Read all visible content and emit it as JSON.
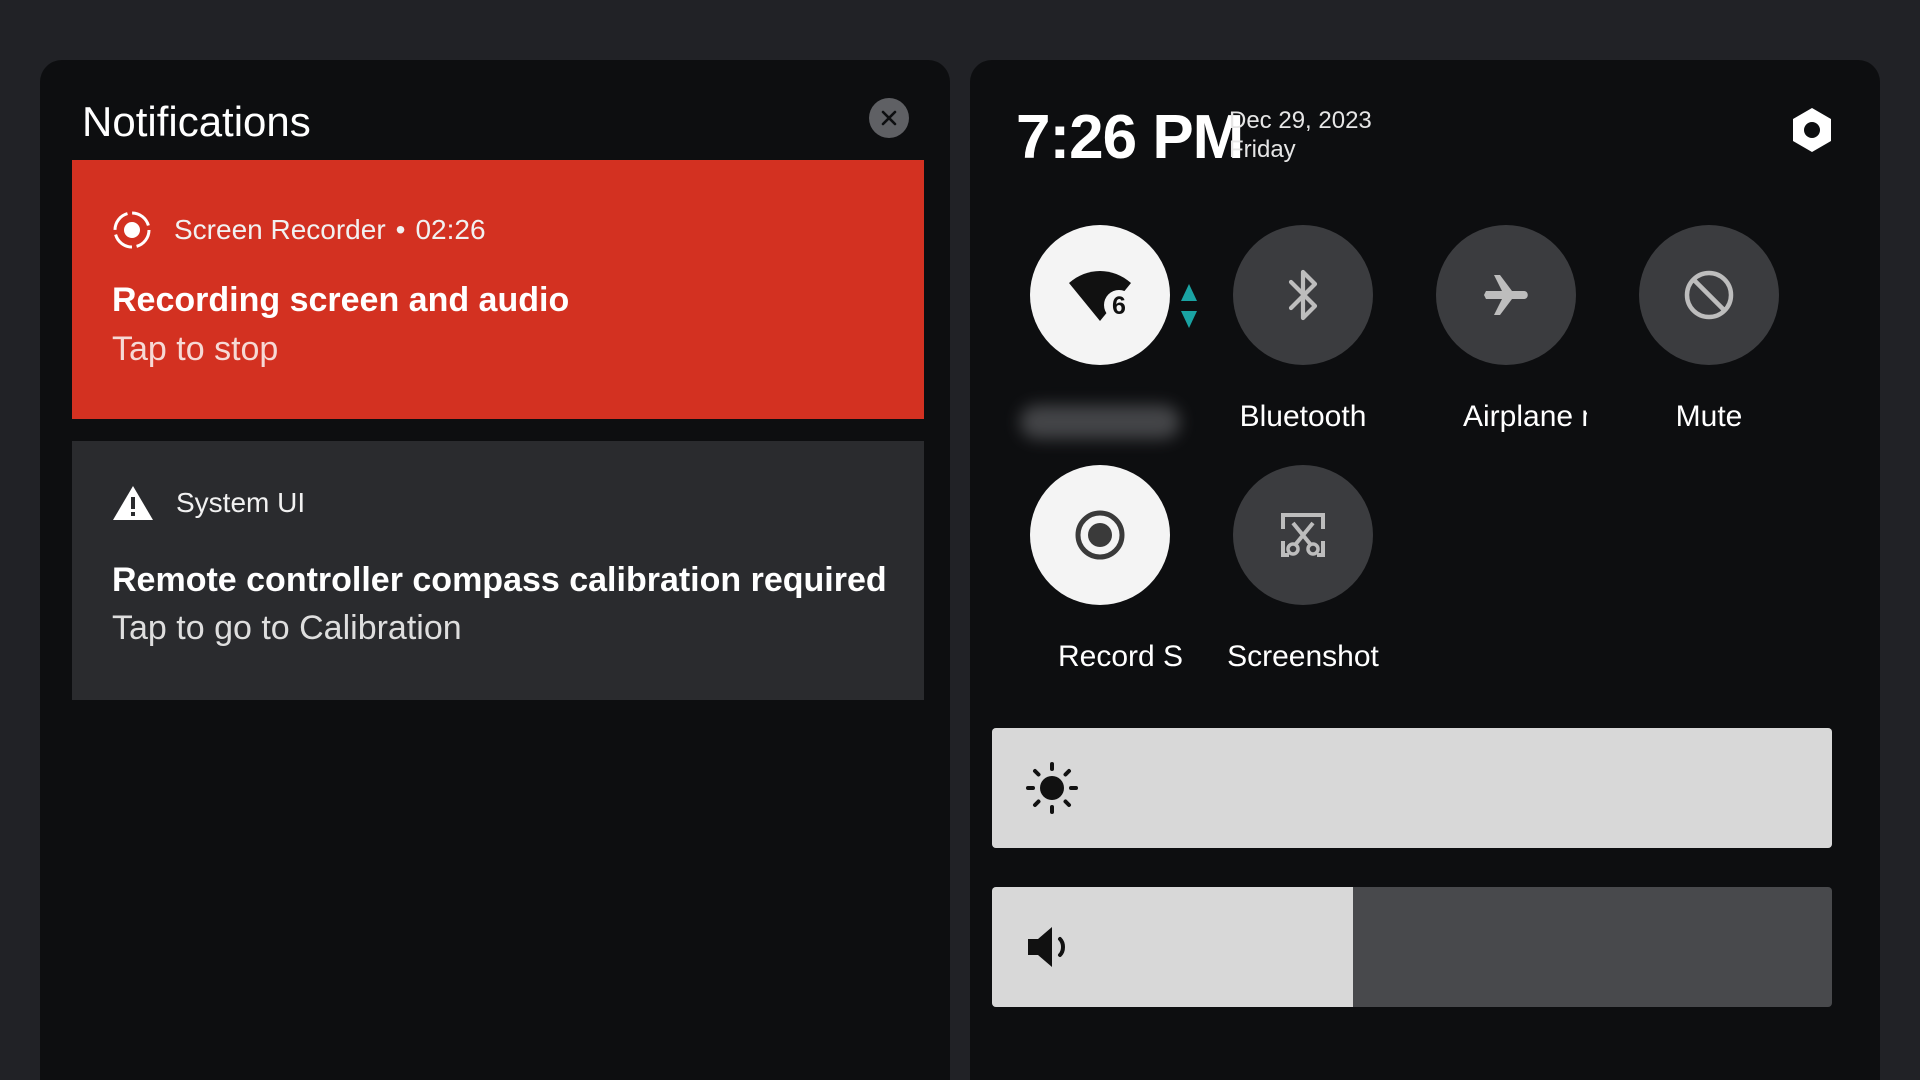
{
  "notifications": {
    "title": "Notifications",
    "items": [
      {
        "app": "Screen Recorder",
        "separator": "•",
        "time": "02:26",
        "title": "Recording screen and audio",
        "subtitle": "Tap to stop",
        "icon": "screen-record-icon",
        "color": "#d33121"
      },
      {
        "app": "System UI",
        "title": "Remote controller compass calibration required",
        "subtitle": "Tap to go to Calibration",
        "icon": "warning-icon",
        "color": "#2a2b2e"
      }
    ]
  },
  "quick_settings": {
    "time": "7:26 PM",
    "date": "Dec 29, 2023",
    "day": "Friday",
    "tiles": [
      {
        "name": "wifi",
        "label": "",
        "icon": "wifi-6-icon",
        "state": "on",
        "badge": "6"
      },
      {
        "name": "bluetooth",
        "label": "Bluetooth",
        "icon": "bluetooth-icon",
        "state": "off"
      },
      {
        "name": "airplane",
        "label": "Airplane mode",
        "icon": "airplane-icon",
        "state": "off"
      },
      {
        "name": "mute",
        "label": "Mute",
        "icon": "mute-icon",
        "state": "off"
      },
      {
        "name": "record-screen",
        "label": "Record Screen",
        "icon": "record-icon",
        "state": "on"
      },
      {
        "name": "screenshot",
        "label": "Screenshot",
        "icon": "screenshot-icon",
        "state": "off"
      }
    ],
    "brightness": {
      "icon": "brightness-icon",
      "level_percent": 100
    },
    "volume": {
      "icon": "volume-icon",
      "level_percent": 43
    }
  },
  "colors": {
    "background": "#212226",
    "panel": "#0d0e10",
    "accent_red": "#d33121",
    "tile_on": "#f4f4f4",
    "tile_off": "#3b3c3f",
    "wifi_arrows": "#1aa3a3"
  }
}
